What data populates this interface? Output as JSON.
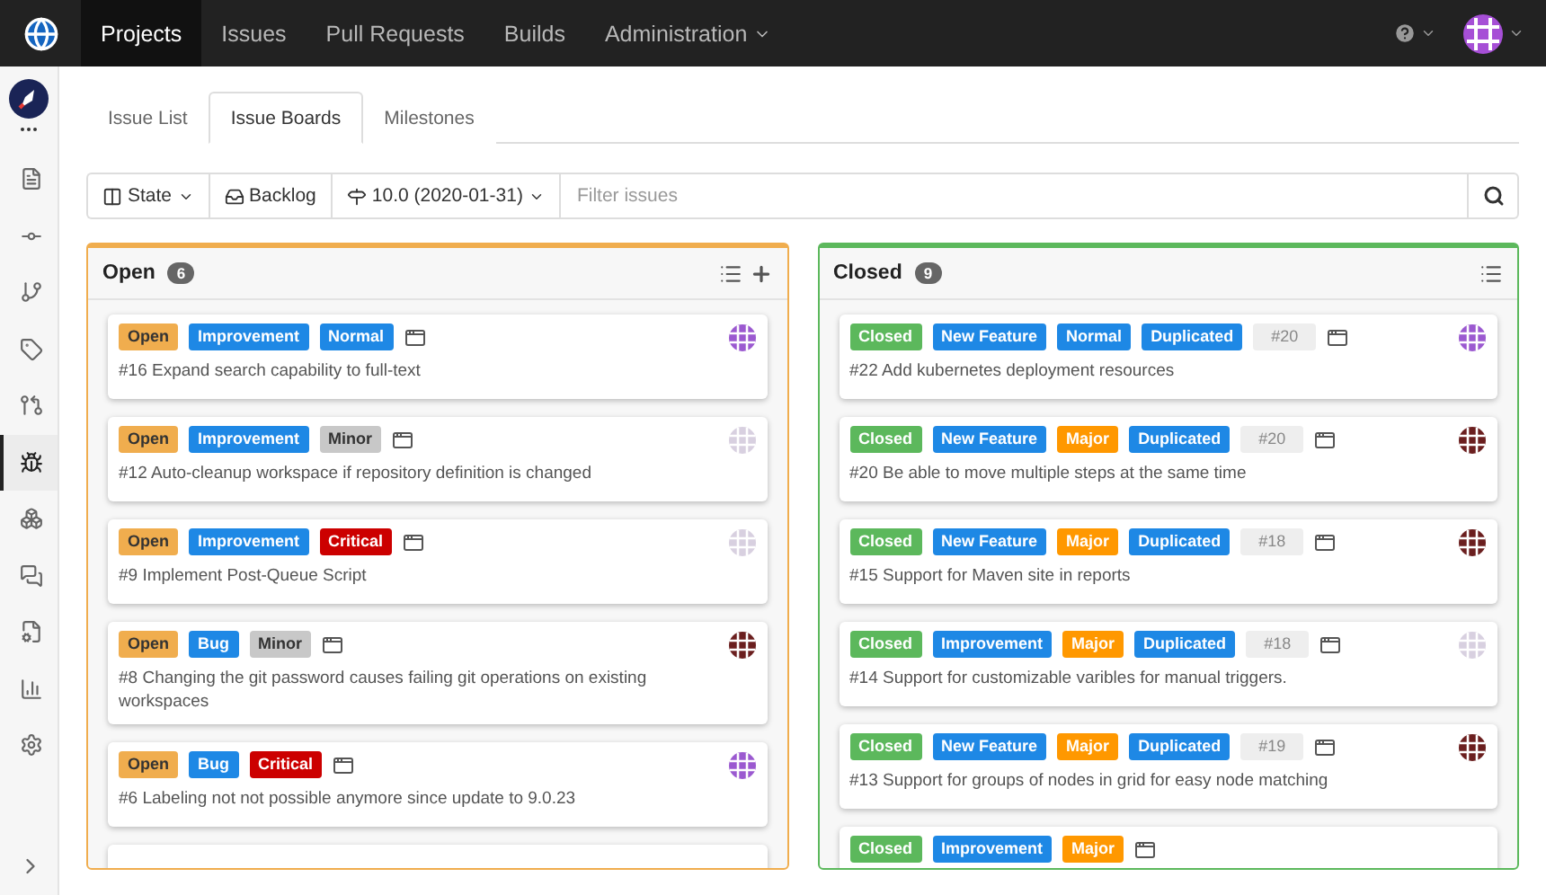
{
  "topbar": {
    "nav": [
      {
        "label": "Projects",
        "selected": true
      },
      {
        "label": "Issues",
        "selected": false
      },
      {
        "label": "Pull Requests",
        "selected": false
      },
      {
        "label": "Builds",
        "selected": false
      },
      {
        "label": "Administration",
        "selected": false,
        "dropdown": true
      }
    ]
  },
  "sidebar": {
    "items": [
      {
        "selected": false
      },
      {
        "selected": false
      },
      {
        "selected": false
      },
      {
        "selected": false
      },
      {
        "selected": false
      },
      {
        "selected": true
      },
      {
        "selected": false
      },
      {
        "selected": false
      },
      {
        "selected": false
      },
      {
        "selected": false
      },
      {
        "selected": false
      }
    ]
  },
  "tabs": [
    {
      "label": "Issue List",
      "selected": false
    },
    {
      "label": "Issue Boards",
      "selected": true
    },
    {
      "label": "Milestones",
      "selected": false
    }
  ],
  "toolbar": {
    "state": "State",
    "backlog": "Backlog",
    "milestone": "10.0 (2020-01-31)",
    "search": {
      "placeholder": "Filter issues"
    }
  },
  "columns": [
    {
      "title": "Open",
      "count": "6",
      "color": "#f0ad4e",
      "add": true,
      "cards": [
        {
          "labels": [
            {
              "kind": "tag",
              "text": "Open",
              "color": "#f0ad4e"
            },
            {
              "kind": "tag",
              "text": "Improvement",
              "color": "#1e88e5"
            },
            {
              "kind": "tag",
              "text": "Normal",
              "color": "#1e88e5"
            }
          ],
          "title": "#16 Expand search capability to full-text",
          "avatar": {
            "color": "#9b59d0"
          }
        },
        {
          "labels": [
            {
              "kind": "tag",
              "text": "Open",
              "color": "#f0ad4e"
            },
            {
              "kind": "tag",
              "text": "Improvement",
              "color": "#1e88e5"
            },
            {
              "kind": "tag",
              "text": "Minor",
              "color": "#c8c8c8"
            }
          ],
          "title": "#12 Auto-cleanup workspace if repository definition is changed",
          "avatar": {
            "color": "#d8d0e0"
          }
        },
        {
          "labels": [
            {
              "kind": "tag",
              "text": "Open",
              "color": "#f0ad4e"
            },
            {
              "kind": "tag",
              "text": "Improvement",
              "color": "#1e88e5"
            },
            {
              "kind": "tag",
              "text": "Critical",
              "color": "#cc0000"
            }
          ],
          "title": "#9 Implement Post-Queue Script",
          "avatar": {
            "color": "#d8d0e0"
          }
        },
        {
          "labels": [
            {
              "kind": "tag",
              "text": "Open",
              "color": "#f0ad4e"
            },
            {
              "kind": "tag",
              "text": "Bug",
              "color": "#1e88e5"
            },
            {
              "kind": "tag",
              "text": "Minor",
              "color": "#c8c8c8"
            }
          ],
          "title": "#8 Changing the git password causes failing git operations on existing workspaces",
          "avatar": {
            "color": "#6b1f1f"
          }
        },
        {
          "labels": [
            {
              "kind": "tag",
              "text": "Open",
              "color": "#f0ad4e"
            },
            {
              "kind": "tag",
              "text": "Bug",
              "color": "#1e88e5"
            },
            {
              "kind": "tag",
              "text": "Critical",
              "color": "#cc0000"
            }
          ],
          "title": "#6 Labeling not not possible anymore since update to 9.0.23",
          "avatar": {
            "color": "#9b59d0"
          }
        }
      ]
    },
    {
      "title": "Closed",
      "count": "9",
      "color": "#5cb85c",
      "add": false,
      "cards": [
        {
          "labels": [
            {
              "kind": "tag",
              "text": "Closed",
              "color": "#5cb85c"
            },
            {
              "kind": "tag",
              "text": "New Feature",
              "color": "#1e88e5"
            },
            {
              "kind": "tag",
              "text": "Normal",
              "color": "#1e88e5"
            },
            {
              "kind": "tag",
              "text": "Duplicated",
              "color": "#1e88e5"
            },
            {
              "kind": "ref",
              "text": "#20"
            }
          ],
          "title": "#22 Add kubernetes deployment resources",
          "avatar": {
            "color": "#9b59d0"
          }
        },
        {
          "labels": [
            {
              "kind": "tag",
              "text": "Closed",
              "color": "#5cb85c"
            },
            {
              "kind": "tag",
              "text": "New Feature",
              "color": "#1e88e5"
            },
            {
              "kind": "tag",
              "text": "Major",
              "color": "#ff9800"
            },
            {
              "kind": "tag",
              "text": "Duplicated",
              "color": "#1e88e5"
            },
            {
              "kind": "ref",
              "text": "#20"
            }
          ],
          "title": "#20 Be able to move multiple steps at the same time",
          "avatar": {
            "color": "#6b1f1f"
          }
        },
        {
          "labels": [
            {
              "kind": "tag",
              "text": "Closed",
              "color": "#5cb85c"
            },
            {
              "kind": "tag",
              "text": "New Feature",
              "color": "#1e88e5"
            },
            {
              "kind": "tag",
              "text": "Major",
              "color": "#ff9800"
            },
            {
              "kind": "tag",
              "text": "Duplicated",
              "color": "#1e88e5"
            },
            {
              "kind": "ref",
              "text": "#18"
            }
          ],
          "title": "#15 Support for Maven site in reports",
          "avatar": {
            "color": "#6b1f1f"
          }
        },
        {
          "labels": [
            {
              "kind": "tag",
              "text": "Closed",
              "color": "#5cb85c"
            },
            {
              "kind": "tag",
              "text": "Improvement",
              "color": "#1e88e5"
            },
            {
              "kind": "tag",
              "text": "Major",
              "color": "#ff9800"
            },
            {
              "kind": "tag",
              "text": "Duplicated",
              "color": "#1e88e5"
            },
            {
              "kind": "ref",
              "text": "#18"
            }
          ],
          "title": "#14 Support for customizable varibles for manual triggers.",
          "avatar": {
            "color": "#d8d0e0"
          }
        },
        {
          "labels": [
            {
              "kind": "tag",
              "text": "Closed",
              "color": "#5cb85c"
            },
            {
              "kind": "tag",
              "text": "New Feature",
              "color": "#1e88e5"
            },
            {
              "kind": "tag",
              "text": "Major",
              "color": "#ff9800"
            },
            {
              "kind": "tag",
              "text": "Duplicated",
              "color": "#1e88e5"
            },
            {
              "kind": "ref",
              "text": "#19"
            }
          ],
          "title": "#13 Support for groups of nodes in grid for easy node matching",
          "avatar": {
            "color": "#6b1f1f"
          }
        },
        {
          "labels": [
            {
              "kind": "tag",
              "text": "Closed",
              "color": "#5cb85c"
            },
            {
              "kind": "tag",
              "text": "Improvement",
              "color": "#1e88e5"
            },
            {
              "kind": "tag",
              "text": "Major",
              "color": "#ff9800"
            }
          ]
        }
      ]
    }
  ]
}
